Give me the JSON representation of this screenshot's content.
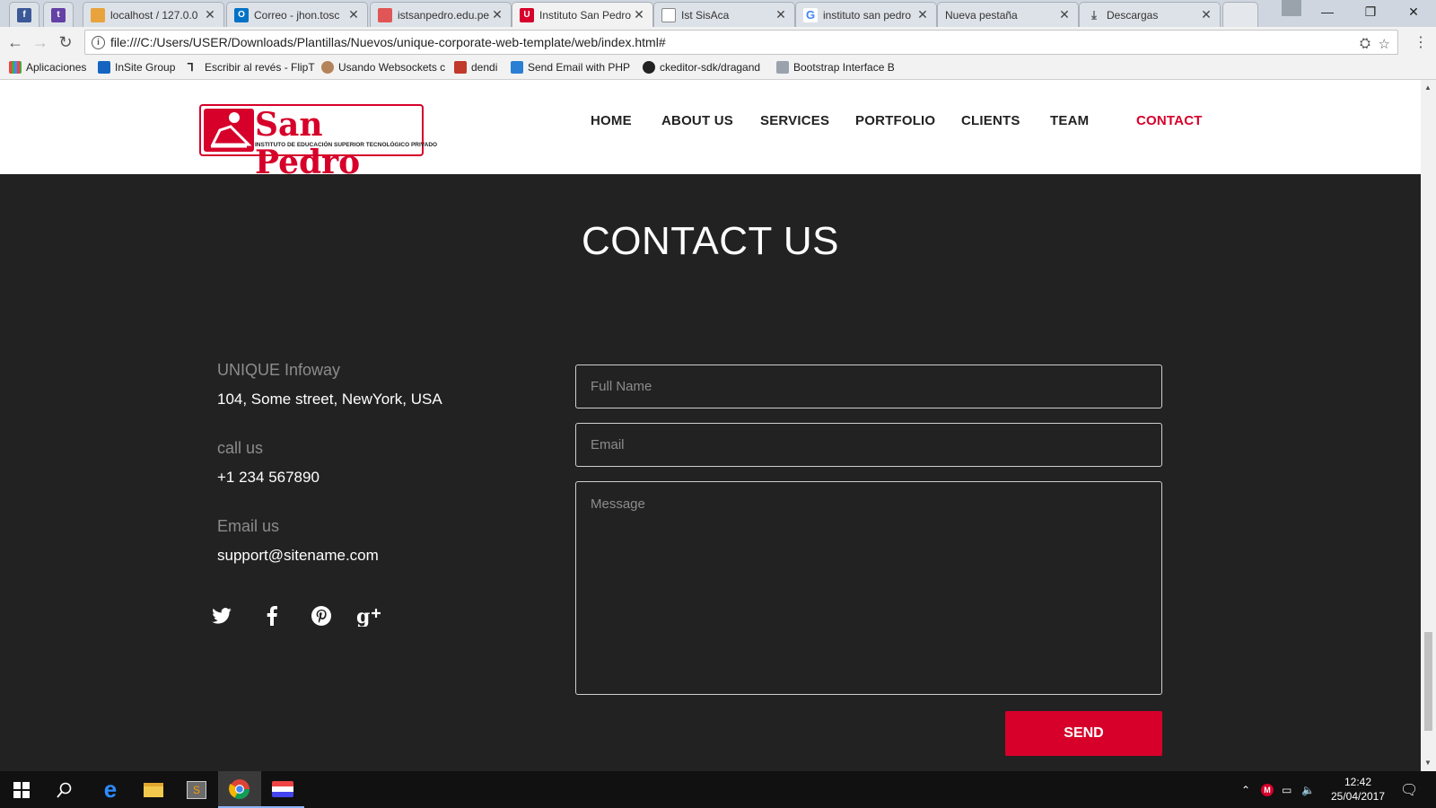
{
  "browser": {
    "tabs": [
      {
        "label": "",
        "icon": "facebook-icon"
      },
      {
        "label": "",
        "icon": "twitch-icon"
      },
      {
        "label": "localhost / 127.0.0",
        "icon": "phpmyadmin-icon"
      },
      {
        "label": "Correo - jhon.tosc",
        "icon": "outlook-icon"
      },
      {
        "label": "istsanpedro.edu.pe",
        "icon": "site-icon"
      },
      {
        "label": "Instituto San Pedro",
        "icon": "sanpedro-icon"
      },
      {
        "label": "Ist SisAca",
        "icon": "page-icon"
      },
      {
        "label": "instituto san pedro",
        "icon": "google-icon"
      },
      {
        "label": "Nueva pestaña",
        "icon": ""
      },
      {
        "label": "Descargas",
        "icon": "download-icon"
      }
    ],
    "url": "file:///C:/Users/USER/Downloads/Plantillas/Nuevos/unique-corporate-web-template/web/index.html#",
    "bookmarks": [
      "Aplicaciones",
      "InSite Group",
      "Escribir al revés - FlipT",
      "Usando Websockets c",
      "dendi",
      "Send Email with PHP",
      "ckeditor-sdk/dragand",
      "Bootstrap Interface B"
    ]
  },
  "site": {
    "logo": {
      "name": "San Pedro",
      "tagline": "INSTITUTO DE EDUCACIÓN SUPERIOR TECNOLÓGICO PRIVADO"
    },
    "nav": [
      "HOME",
      "ABOUT US",
      "SERVICES",
      "PORTFOLIO",
      "CLIENTS",
      "TEAM",
      "CONTACT"
    ],
    "active_nav": "CONTACT",
    "section_title": "CONTACT US",
    "contact_info": {
      "company_label": "UNIQUE Infoway",
      "address": "104, Some street, NewYork, USA",
      "call_label": "call us",
      "phone": "+1 234 567890",
      "email_label": "Email us",
      "email": "support@sitename.com"
    },
    "social_icons": [
      "twitter-icon",
      "facebook-icon",
      "pinterest-icon",
      "google-plus-icon"
    ],
    "form": {
      "name_placeholder": "Full Name",
      "email_placeholder": "Email",
      "message_placeholder": "Message",
      "send_label": "SEND"
    },
    "colors": {
      "accent": "#d6002a",
      "background": "#222222",
      "header": "#ffffff"
    }
  },
  "taskbar": {
    "time": "12:42",
    "date": "25/04/2017"
  }
}
